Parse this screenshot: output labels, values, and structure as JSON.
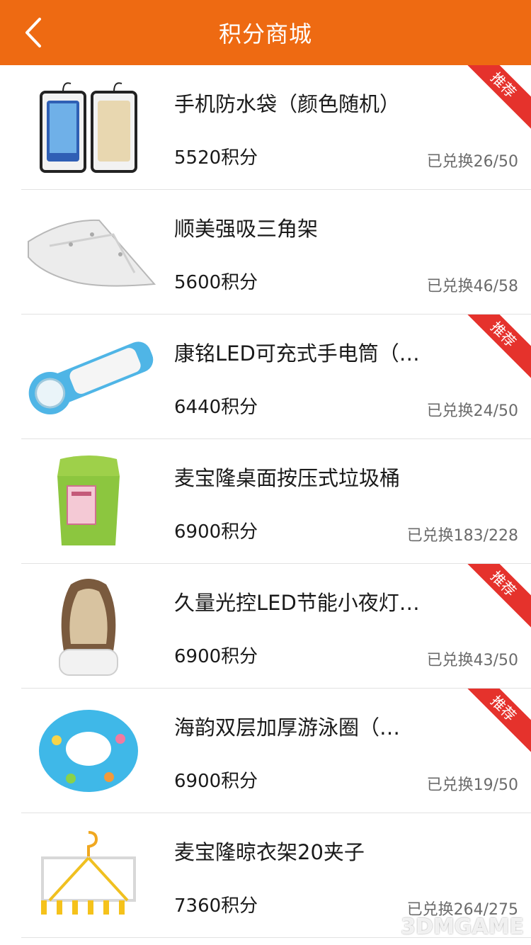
{
  "nav": {
    "title": "积分商城"
  },
  "items": [
    {
      "name": "手机防水袋（颜色随机）",
      "points": "5520积分",
      "exchanged": "已兑换26/50",
      "badge": "推荐",
      "icon": "waterproof-bag"
    },
    {
      "name": "顺美强吸三角架",
      "points": "5600积分",
      "exchanged": "已兑换46/58",
      "badge": "",
      "icon": "corner-shelf"
    },
    {
      "name": "康铭LED可充式手电筒（…",
      "points": "6440积分",
      "exchanged": "已兑换24/50",
      "badge": "推荐",
      "icon": "flashlight"
    },
    {
      "name": "麦宝隆桌面按压式垃圾桶",
      "points": "6900积分",
      "exchanged": "已兑换183/228",
      "badge": "",
      "icon": "trash-bin"
    },
    {
      "name": "久量光控LED节能小夜灯…",
      "points": "6900积分",
      "exchanged": "已兑换43/50",
      "badge": "推荐",
      "icon": "night-light"
    },
    {
      "name": "海韵双层加厚游泳圈（…",
      "points": "6900积分",
      "exchanged": "已兑换19/50",
      "badge": "推荐",
      "icon": "swim-ring"
    },
    {
      "name": "麦宝隆晾衣架20夹子",
      "points": "7360积分",
      "exchanged": "已兑换264/275",
      "badge": "",
      "icon": "clothes-hanger"
    }
  ],
  "watermark": "3DMGAME",
  "colors": {
    "header": "#ee6a12",
    "badge": "#e5322c"
  }
}
